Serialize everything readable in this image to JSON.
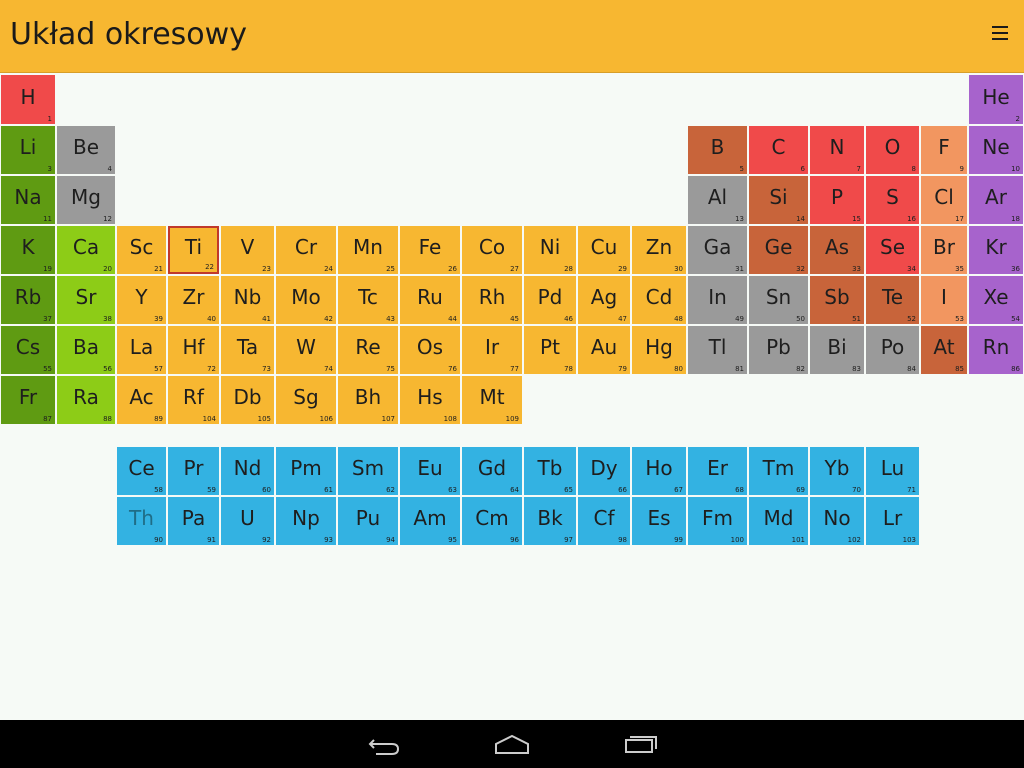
{
  "app": {
    "title": "Układ okresowy",
    "menu_icon": "hamburger-menu-icon"
  },
  "colors": {
    "alkali": "#5f9b12",
    "alkaline": "#8dcc17",
    "metal_gray": "#9a9a9a",
    "transition": "#f7b731",
    "metalloid": "#c8643a",
    "nonmetal": "#f04a4a",
    "halogen": "#f29660",
    "noble": "#a763cc",
    "f_block": "#33b2e2"
  },
  "selected_symbol": "Ti",
  "main_table": [
    [
      {
        "s": "H",
        "n": "1",
        "c": "nonmetal"
      },
      null,
      null,
      null,
      null,
      null,
      null,
      null,
      null,
      null,
      null,
      null,
      null,
      null,
      null,
      null,
      null,
      {
        "s": "He",
        "n": "2",
        "c": "noble"
      }
    ],
    [
      {
        "s": "Li",
        "n": "3",
        "c": "alkali"
      },
      {
        "s": "Be",
        "n": "4",
        "c": "metal_gray"
      },
      null,
      null,
      null,
      null,
      null,
      null,
      null,
      null,
      null,
      null,
      {
        "s": "B",
        "n": "5",
        "c": "metalloid"
      },
      {
        "s": "C",
        "n": "6",
        "c": "nonmetal"
      },
      {
        "s": "N",
        "n": "7",
        "c": "nonmetal"
      },
      {
        "s": "O",
        "n": "8",
        "c": "nonmetal"
      },
      {
        "s": "F",
        "n": "9",
        "c": "halogen"
      },
      {
        "s": "Ne",
        "n": "10",
        "c": "noble"
      }
    ],
    [
      {
        "s": "Na",
        "n": "11",
        "c": "alkali"
      },
      {
        "s": "Mg",
        "n": "12",
        "c": "metal_gray"
      },
      null,
      null,
      null,
      null,
      null,
      null,
      null,
      null,
      null,
      null,
      {
        "s": "Al",
        "n": "13",
        "c": "metal_gray"
      },
      {
        "s": "Si",
        "n": "14",
        "c": "metalloid"
      },
      {
        "s": "P",
        "n": "15",
        "c": "nonmetal"
      },
      {
        "s": "S",
        "n": "16",
        "c": "nonmetal"
      },
      {
        "s": "Cl",
        "n": "17",
        "c": "halogen"
      },
      {
        "s": "Ar",
        "n": "18",
        "c": "noble"
      }
    ],
    [
      {
        "s": "K",
        "n": "19",
        "c": "alkali"
      },
      {
        "s": "Ca",
        "n": "20",
        "c": "alkaline"
      },
      {
        "s": "Sc",
        "n": "21",
        "c": "transition"
      },
      {
        "s": "Ti",
        "n": "22",
        "c": "transition"
      },
      {
        "s": "V",
        "n": "23",
        "c": "transition"
      },
      {
        "s": "Cr",
        "n": "24",
        "c": "transition"
      },
      {
        "s": "Mn",
        "n": "25",
        "c": "transition"
      },
      {
        "s": "Fe",
        "n": "26",
        "c": "transition"
      },
      {
        "s": "Co",
        "n": "27",
        "c": "transition"
      },
      {
        "s": "Ni",
        "n": "28",
        "c": "transition"
      },
      {
        "s": "Cu",
        "n": "29",
        "c": "transition"
      },
      {
        "s": "Zn",
        "n": "30",
        "c": "transition"
      },
      {
        "s": "Ga",
        "n": "31",
        "c": "metal_gray"
      },
      {
        "s": "Ge",
        "n": "32",
        "c": "metalloid"
      },
      {
        "s": "As",
        "n": "33",
        "c": "metalloid"
      },
      {
        "s": "Se",
        "n": "34",
        "c": "nonmetal"
      },
      {
        "s": "Br",
        "n": "35",
        "c": "halogen"
      },
      {
        "s": "Kr",
        "n": "36",
        "c": "noble"
      }
    ],
    [
      {
        "s": "Rb",
        "n": "37",
        "c": "alkali"
      },
      {
        "s": "Sr",
        "n": "38",
        "c": "alkaline"
      },
      {
        "s": "Y",
        "n": "39",
        "c": "transition"
      },
      {
        "s": "Zr",
        "n": "40",
        "c": "transition"
      },
      {
        "s": "Nb",
        "n": "41",
        "c": "transition"
      },
      {
        "s": "Mo",
        "n": "42",
        "c": "transition"
      },
      {
        "s": "Tc",
        "n": "43",
        "c": "transition"
      },
      {
        "s": "Ru",
        "n": "44",
        "c": "transition"
      },
      {
        "s": "Rh",
        "n": "45",
        "c": "transition"
      },
      {
        "s": "Pd",
        "n": "46",
        "c": "transition"
      },
      {
        "s": "Ag",
        "n": "47",
        "c": "transition"
      },
      {
        "s": "Cd",
        "n": "48",
        "c": "transition"
      },
      {
        "s": "In",
        "n": "49",
        "c": "metal_gray"
      },
      {
        "s": "Sn",
        "n": "50",
        "c": "metal_gray"
      },
      {
        "s": "Sb",
        "n": "51",
        "c": "metalloid"
      },
      {
        "s": "Te",
        "n": "52",
        "c": "metalloid"
      },
      {
        "s": "I",
        "n": "53",
        "c": "halogen"
      },
      {
        "s": "Xe",
        "n": "54",
        "c": "noble"
      }
    ],
    [
      {
        "s": "Cs",
        "n": "55",
        "c": "alkali"
      },
      {
        "s": "Ba",
        "n": "56",
        "c": "alkaline"
      },
      {
        "s": "La",
        "n": "57",
        "c": "transition"
      },
      {
        "s": "Hf",
        "n": "72",
        "c": "transition"
      },
      {
        "s": "Ta",
        "n": "73",
        "c": "transition"
      },
      {
        "s": "W",
        "n": "74",
        "c": "transition"
      },
      {
        "s": "Re",
        "n": "75",
        "c": "transition"
      },
      {
        "s": "Os",
        "n": "76",
        "c": "transition"
      },
      {
        "s": "Ir",
        "n": "77",
        "c": "transition"
      },
      {
        "s": "Pt",
        "n": "78",
        "c": "transition"
      },
      {
        "s": "Au",
        "n": "79",
        "c": "transition"
      },
      {
        "s": "Hg",
        "n": "80",
        "c": "transition"
      },
      {
        "s": "Tl",
        "n": "81",
        "c": "metal_gray"
      },
      {
        "s": "Pb",
        "n": "82",
        "c": "metal_gray"
      },
      {
        "s": "Bi",
        "n": "83",
        "c": "metal_gray"
      },
      {
        "s": "Po",
        "n": "84",
        "c": "metal_gray"
      },
      {
        "s": "At",
        "n": "85",
        "c": "metalloid"
      },
      {
        "s": "Rn",
        "n": "86",
        "c": "noble"
      }
    ],
    [
      {
        "s": "Fr",
        "n": "87",
        "c": "alkali"
      },
      {
        "s": "Ra",
        "n": "88",
        "c": "alkaline"
      },
      {
        "s": "Ac",
        "n": "89",
        "c": "transition"
      },
      {
        "s": "Rf",
        "n": "104",
        "c": "transition"
      },
      {
        "s": "Db",
        "n": "105",
        "c": "transition"
      },
      {
        "s": "Sg",
        "n": "106",
        "c": "transition"
      },
      {
        "s": "Bh",
        "n": "107",
        "c": "transition"
      },
      {
        "s": "Hs",
        "n": "108",
        "c": "transition"
      },
      {
        "s": "Mt",
        "n": "109",
        "c": "transition"
      },
      null,
      null,
      null,
      null,
      null,
      null,
      null,
      null,
      null
    ]
  ],
  "f_block": [
    [
      {
        "s": "Ce",
        "n": "58"
      },
      {
        "s": "Pr",
        "n": "59"
      },
      {
        "s": "Nd",
        "n": "60"
      },
      {
        "s": "Pm",
        "n": "61"
      },
      {
        "s": "Sm",
        "n": "62"
      },
      {
        "s": "Eu",
        "n": "63"
      },
      {
        "s": "Gd",
        "n": "64"
      },
      {
        "s": "Tb",
        "n": "65"
      },
      {
        "s": "Dy",
        "n": "66"
      },
      {
        "s": "Ho",
        "n": "67"
      },
      {
        "s": "Er",
        "n": "68"
      },
      {
        "s": "Tm",
        "n": "69"
      },
      {
        "s": "Yb",
        "n": "70"
      },
      {
        "s": "Lu",
        "n": "71"
      }
    ],
    [
      {
        "s": "Th",
        "n": "90",
        "dim": true
      },
      {
        "s": "Pa",
        "n": "91"
      },
      {
        "s": "U",
        "n": "92"
      },
      {
        "s": "Np",
        "n": "93"
      },
      {
        "s": "Pu",
        "n": "94"
      },
      {
        "s": "Am",
        "n": "95"
      },
      {
        "s": "Cm",
        "n": "96"
      },
      {
        "s": "Bk",
        "n": "97"
      },
      {
        "s": "Cf",
        "n": "98"
      },
      {
        "s": "Es",
        "n": "99"
      },
      {
        "s": "Fm",
        "n": "100"
      },
      {
        "s": "Md",
        "n": "101"
      },
      {
        "s": "No",
        "n": "102"
      },
      {
        "s": "Lr",
        "n": "103"
      }
    ]
  ],
  "nav": {
    "back_icon": "back-icon",
    "home_icon": "home-icon",
    "recents_icon": "recent-apps-icon"
  }
}
